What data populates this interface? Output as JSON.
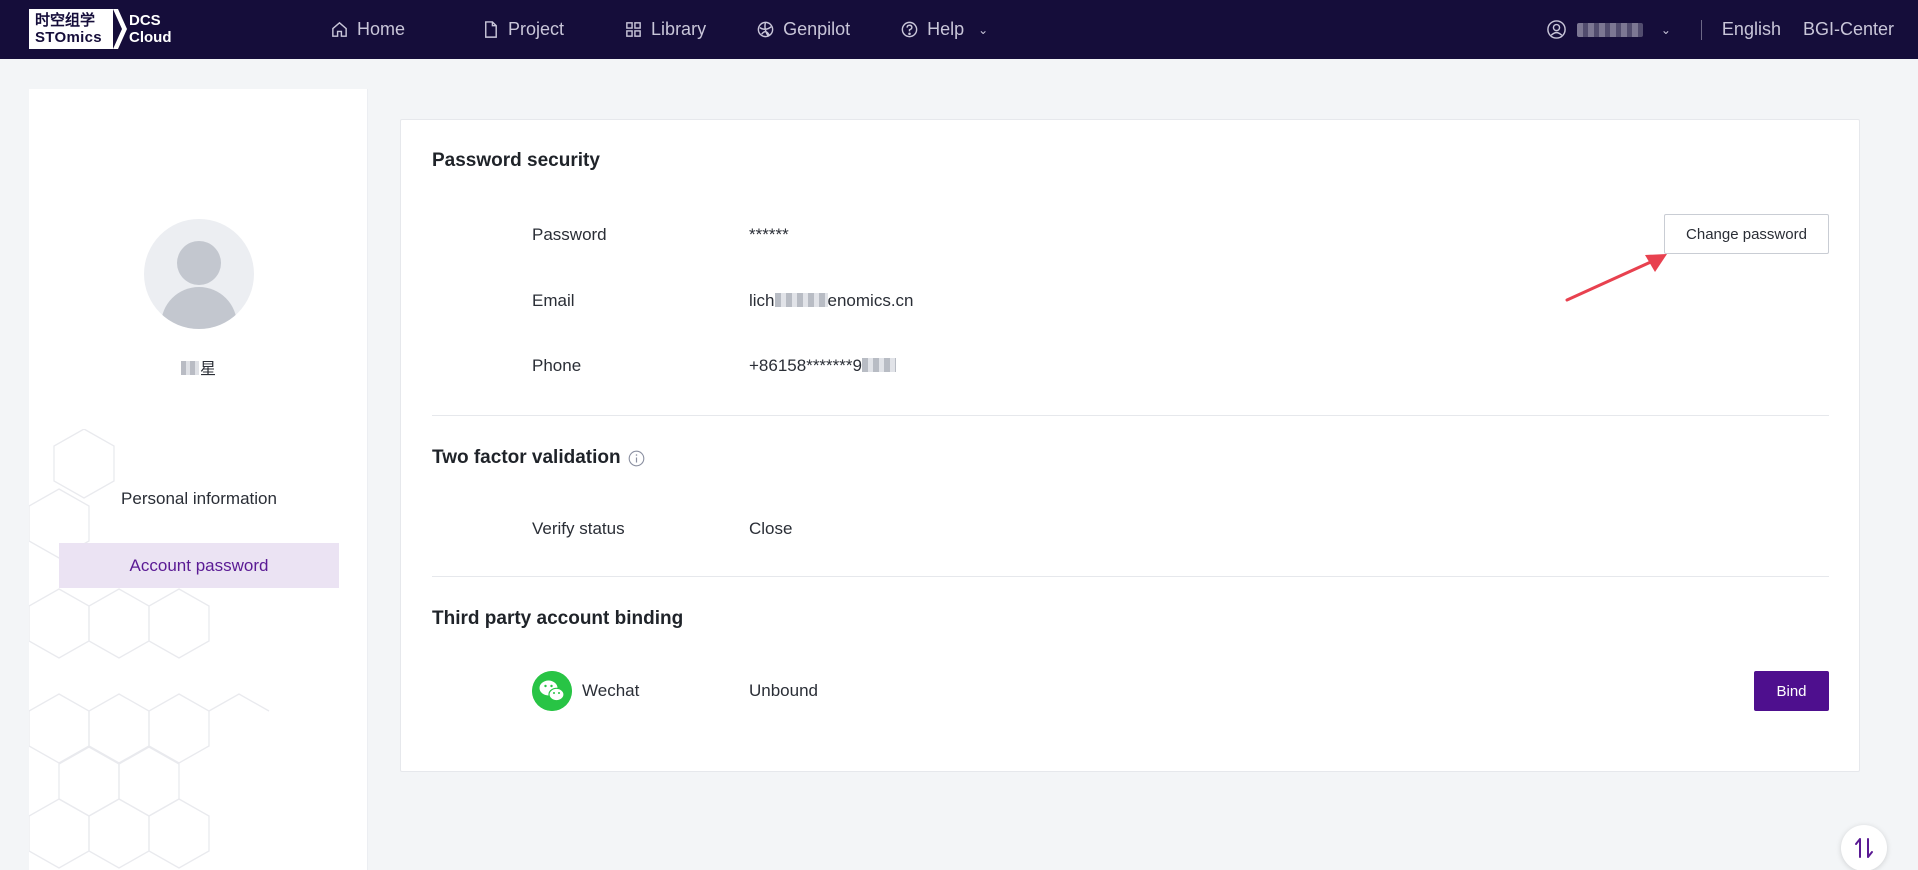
{
  "brand": {
    "logo_line1": "时空组学",
    "logo_line2": "STOmics",
    "product_line1": "DCS",
    "product_line2": "Cloud"
  },
  "nav": {
    "home": "Home",
    "project": "Project",
    "library": "Library",
    "genpilot": "Genpilot",
    "help": "Help"
  },
  "topright": {
    "language": "English",
    "center": "BGI-Center"
  },
  "sidebar": {
    "username_suffix": "星",
    "items": [
      {
        "label": "Personal information"
      },
      {
        "label": "Account password",
        "active": true
      }
    ]
  },
  "password_security": {
    "title": "Password security",
    "password_label": "Password",
    "password_value": "******",
    "email_label": "Email",
    "email_prefix": "lich",
    "email_suffix": "enomics.cn",
    "phone_label": "Phone",
    "phone_value": "+86158*******9",
    "change_button": "Change password"
  },
  "two_factor": {
    "title": "Two factor validation",
    "status_label": "Verify status",
    "status_value": "Close"
  },
  "third_party": {
    "title": "Third party account binding",
    "wechat_label": "Wechat",
    "wechat_status": "Unbound",
    "bind_button": "Bind"
  },
  "colors": {
    "topbar": "#150d3a",
    "accent": "#4e0f8e",
    "active_menu_bg": "#ebe3f3",
    "wechat_green": "#28c445",
    "annotation_arrow": "#e8414f"
  },
  "icons": [
    "home-icon",
    "project-icon",
    "library-icon",
    "genpilot-icon",
    "help-icon",
    "user-icon",
    "info-icon",
    "wechat-icon",
    "scroll-toggle-icon"
  ]
}
